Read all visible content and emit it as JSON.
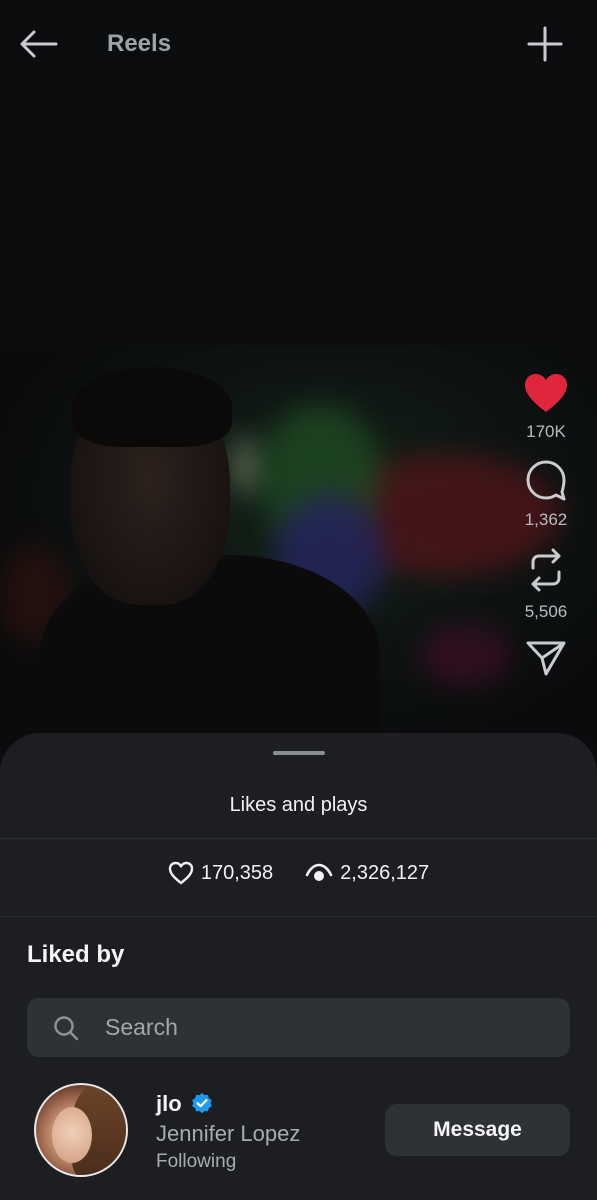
{
  "header": {
    "title": "Reels",
    "back_icon": "arrow-left-icon",
    "add_icon": "plus-icon"
  },
  "rail": {
    "likes_count": "170K",
    "comments_count": "1,362",
    "reposts_count": "5,506",
    "like_color": "#e0263c"
  },
  "sheet": {
    "title": "Likes and plays",
    "likes_total": "170,358",
    "plays_total": "2,326,127",
    "liked_by_label": "Liked by",
    "search_placeholder": "Search",
    "users": [
      {
        "username": "jlo",
        "full_name": "Jennifer Lopez",
        "status": "Following",
        "verified": true,
        "action_label": "Message"
      }
    ]
  },
  "colors": {
    "background": "#0b0c0e",
    "sheet": "#1c1e21",
    "verified": "#1d9bf0"
  }
}
